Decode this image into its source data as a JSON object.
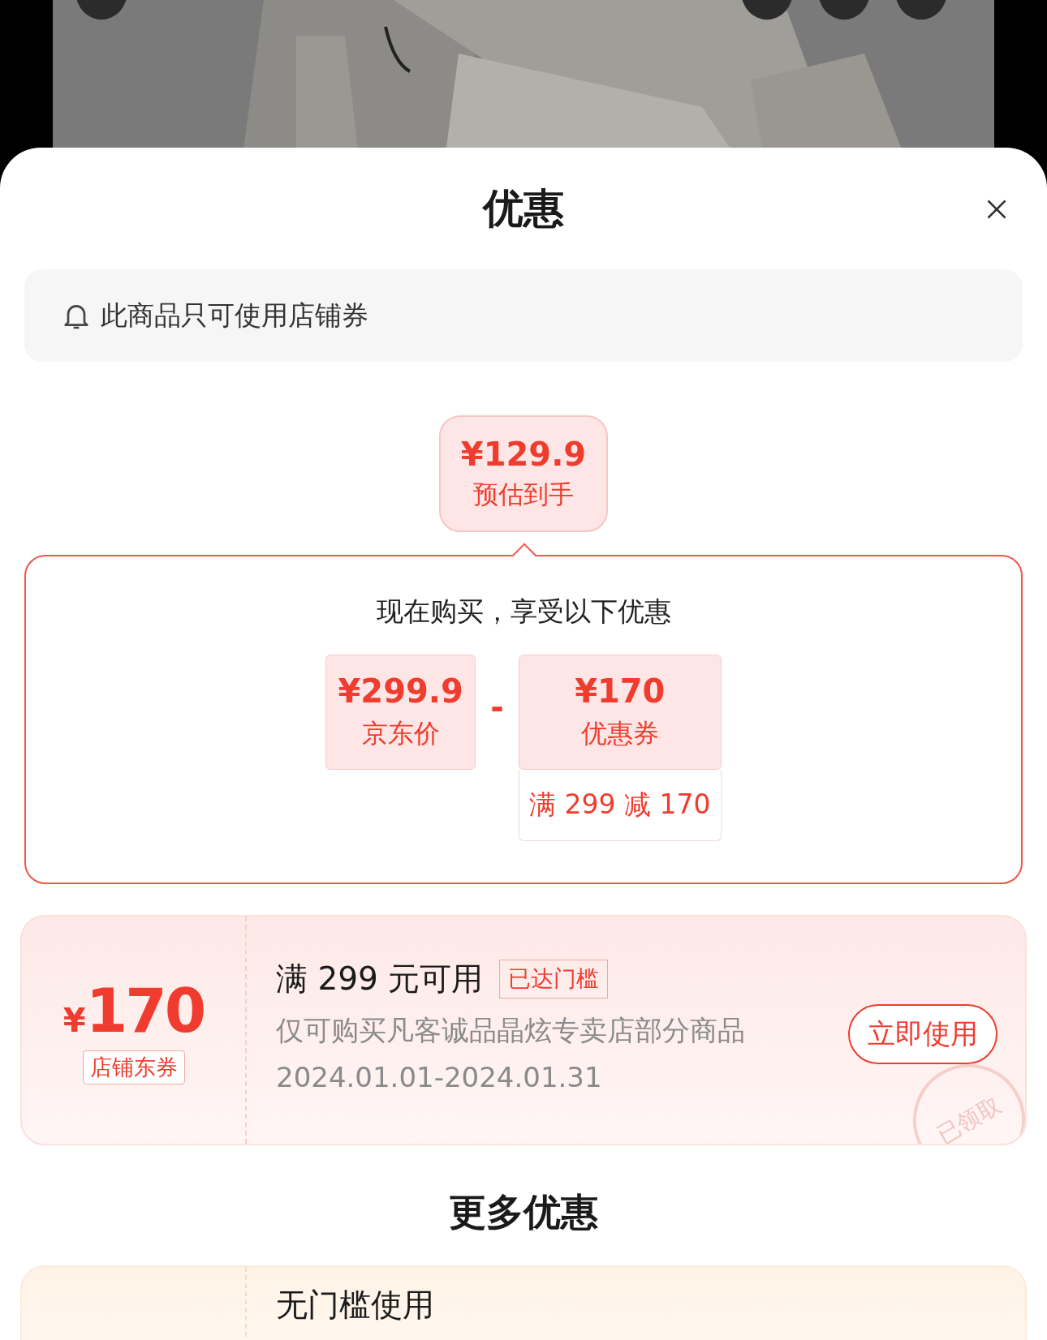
{
  "sheet": {
    "title": "优惠"
  },
  "notice": {
    "text": "此商品只可使用店铺券"
  },
  "estimate": {
    "price": "¥129.9",
    "label": "预估到手"
  },
  "breakdown": {
    "heading": "现在购买，享受以下优惠",
    "original": {
      "price": "¥299.9",
      "label": "京东价"
    },
    "operator": "-",
    "discount": {
      "price": "¥170",
      "label": "优惠券",
      "condition": "满 299 减 170"
    }
  },
  "coupons": [
    {
      "currency": "¥",
      "amount": "170",
      "type_tag": "店铺东券",
      "title": "满 299 元可用",
      "status_tag": "已达门槛",
      "description": "仅可购买凡客诚品晶炫专卖店部分商品",
      "validity": "2024.01.01-2024.01.31",
      "button": "立即使用",
      "stamp": "已领取"
    }
  ],
  "more": {
    "title": "更多优惠",
    "coupons": [
      {
        "title": "无门槛使用"
      }
    ]
  }
}
